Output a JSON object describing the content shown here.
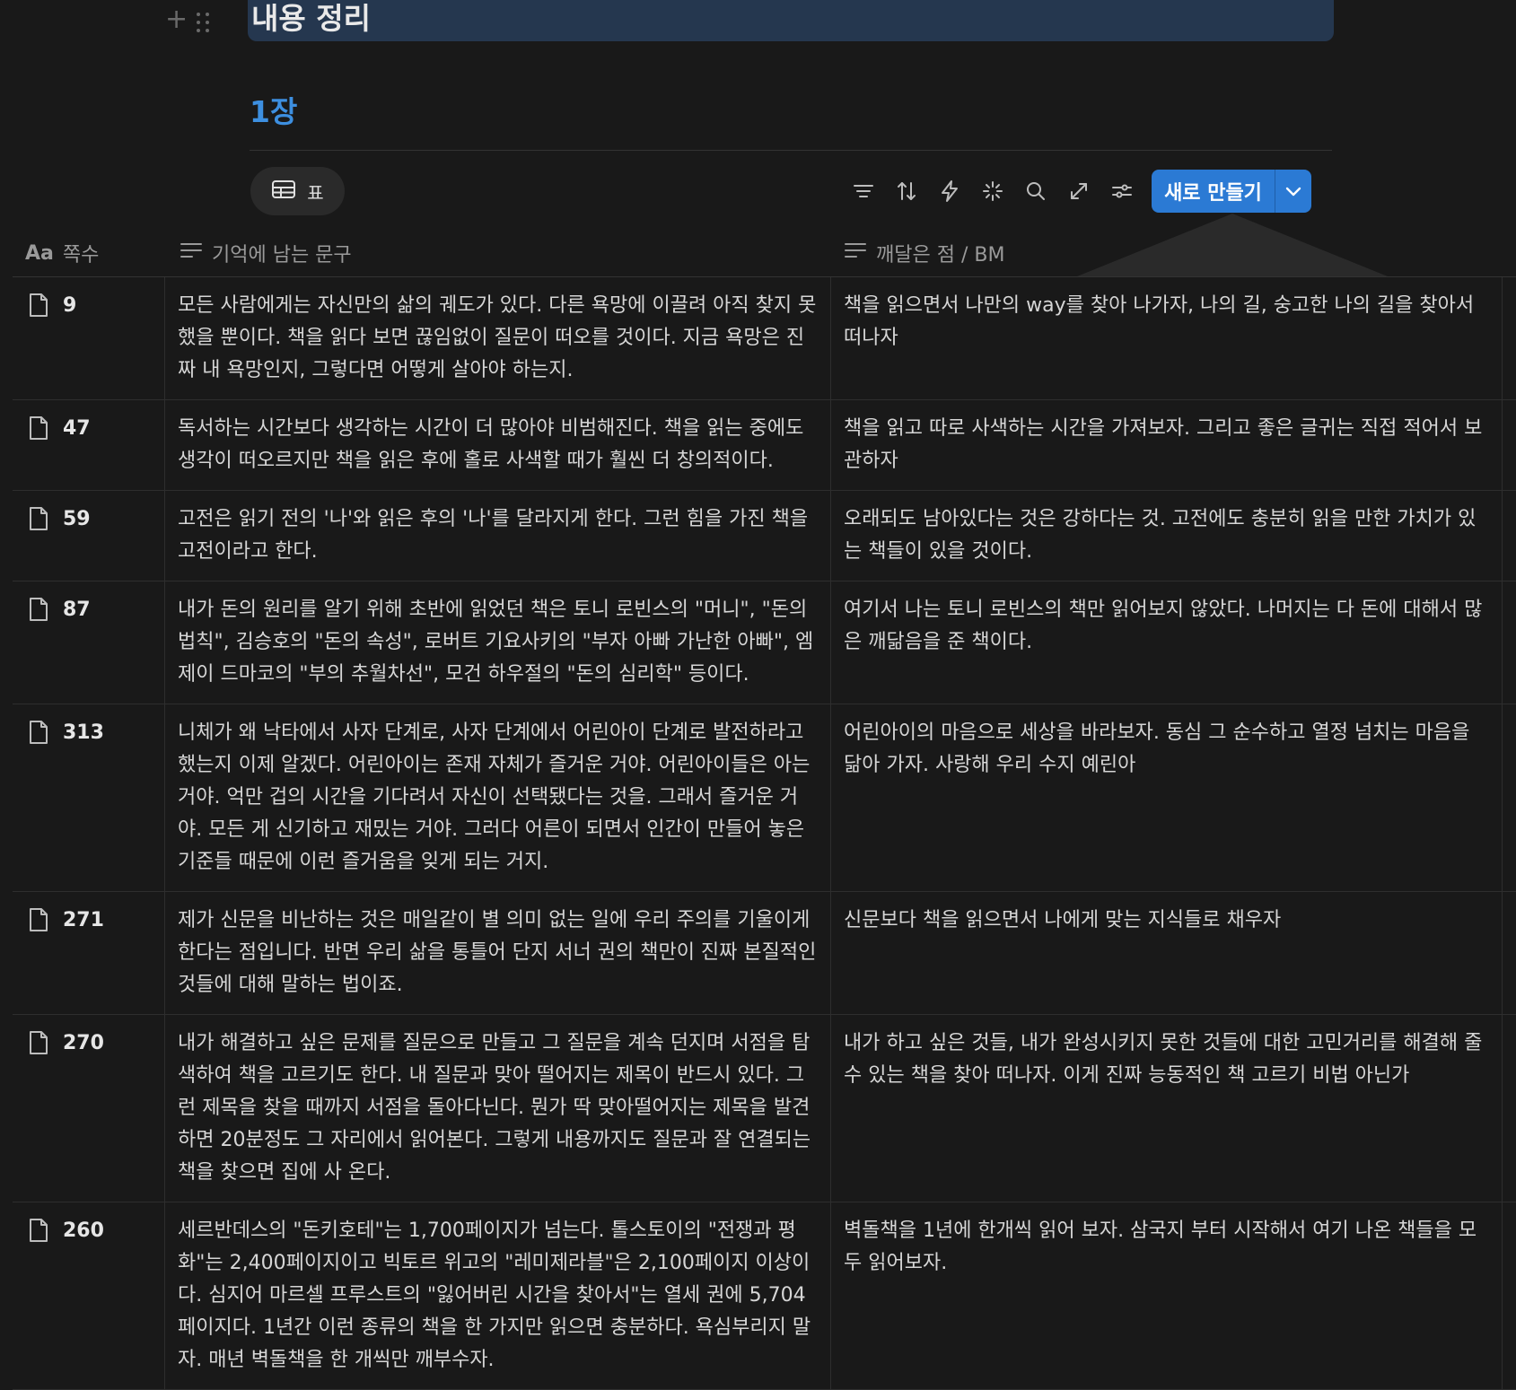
{
  "page": {
    "title": "내용 정리",
    "subheading": "1장"
  },
  "view": {
    "tab_label": "표"
  },
  "toolbar": {
    "icons": [
      "filter-icon",
      "sort-icon",
      "lightning-icon",
      "sparkle-icon",
      "search-icon",
      "expand-icon",
      "settings-sliders-icon"
    ],
    "new_button_label": "새로 만들기"
  },
  "table": {
    "columns": [
      {
        "icon": "Aa",
        "label": "쪽수"
      },
      {
        "icon": "text-lines-icon",
        "label": "기억에 남는 문구"
      },
      {
        "icon": "text-lines-icon",
        "label": "깨달은 점 / BM"
      }
    ],
    "rows": [
      {
        "page": "9",
        "quote": "모든 사람에게는 자신만의 삶의 궤도가 있다. 다른 욕망에 이끌려 아직 찾지 못했을 뿐이다. 책을 읽다 보면 끊임없이 질문이 떠오를 것이다. 지금 욕망은 진짜 내 욕망인지, 그렇다면 어떻게 살아야 하는지.",
        "insight": "책을 읽으면서 나만의 way를 찾아 나가자, 나의 길, 숭고한 나의 길을 찾아서 떠나자"
      },
      {
        "page": "47",
        "quote": "독서하는 시간보다 생각하는 시간이 더 많아야 비범해진다. 책을 읽는 중에도 생각이 떠오르지만 책을 읽은 후에 홀로 사색할 때가 훨씬 더 창의적이다.",
        "insight": "책을 읽고 따로 사색하는 시간을 가져보자. 그리고 좋은 글귀는 직접 적어서 보관하자"
      },
      {
        "page": "59",
        "quote": "고전은 읽기 전의 '나'와 읽은 후의 '나'를 달라지게 한다. 그런 힘을 가진 책을 고전이라고 한다.",
        "insight": "오래되도 남아있다는 것은 강하다는 것. 고전에도 충분히 읽을 만한 가치가 있는 책들이 있을 것이다."
      },
      {
        "page": "87",
        "quote": "내가 돈의 원리를 알기 위해 초반에 읽었던 책은 토니 로빈스의 \"머니\", \"돈의 법칙\", 김승호의 \"돈의 속성\", 로버트 기요사키의 \"부자 아빠 가난한 아빠\", 엠제이 드마코의 \"부의 추월차선\", 모건 하우절의 \"돈의 심리학\" 등이다.",
        "insight": "여기서 나는 토니 로빈스의 책만 읽어보지 않았다. 나머지는 다 돈에 대해서 많은 깨닮음을 준 책이다."
      },
      {
        "page": "313",
        "quote": "니체가 왜 낙타에서 사자 단계로, 사자 단계에서 어린아이 단계로 발전하라고 했는지 이제 알겠다. 어린아이는 존재 자체가 즐거운 거야. 어린아이들은 아는 거야. 억만 겁의 시간을 기다려서 자신이 선택됐다는 것을. 그래서 즐거운 거야. 모든 게 신기하고 재밌는 거야. 그러다 어른이 되면서 인간이 만들어 놓은 기준들 때문에 이런 즐거움을 잊게 되는 거지.",
        "insight": "어린아이의 마음으로 세상을 바라보자. 동심 그 순수하고 열정 넘치는 마음을 닮아 가자. 사랑해 우리 수지 예린아"
      },
      {
        "page": "271",
        "quote": "제가 신문을 비난하는 것은 매일같이 별 의미 없는 일에 우리 주의를 기울이게 한다는 점입니다. 반면 우리 삶을 통틀어 단지 서너 권의 책만이 진짜 본질적인 것들에 대해 말하는 법이죠.",
        "insight": "신문보다 책을 읽으면서 나에게 맞는 지식들로 채우자"
      },
      {
        "page": "270",
        "quote": "내가 해결하고 싶은 문제를 질문으로 만들고 그 질문을 계속 던지며 서점을 탐색하여 책을 고르기도 한다. 내 질문과 맞아 떨어지는 제목이 반드시 있다. 그런 제목을 찾을 때까지 서점을 돌아다닌다. 뭔가 딱 맞아떨어지는 제목을 발견하면 20분정도 그 자리에서 읽어본다. 그렇게 내용까지도 질문과 잘 연결되는 책을 찾으면 집에 사 온다.",
        "insight": "내가 하고 싶은 것들, 내가 완성시키지 못한 것들에 대한 고민거리를 해결해 줄 수 있는 책을 찾아 떠나자. 이게 진짜 능동적인 책 고르기 비법 아닌가"
      },
      {
        "page": "260",
        "quote": "세르반데스의 \"돈키호테\"는 1,700페이지가 넘는다. 톨스토이의 \"전쟁과 평화\"는 2,400페이지이고 빅토르 위고의 \"레미제라블\"은 2,100페이지 이상이다. 심지어 마르셀 프루스트의 \"잃어버린 시간을 찾아서\"는 열세 권에 5,704페이지다. 1년간 이런 종류의 책을 한 가지만 읽으면 충분하다. 욕심부리지 말자. 매년 벽돌책을 한 개씩만 깨부수자.",
        "insight": "벽돌책을 1년에 한개씩 읽어 보자. 삼국지 부터 시작해서 여기 나온 책들을 모두 읽어보자."
      }
    ]
  }
}
